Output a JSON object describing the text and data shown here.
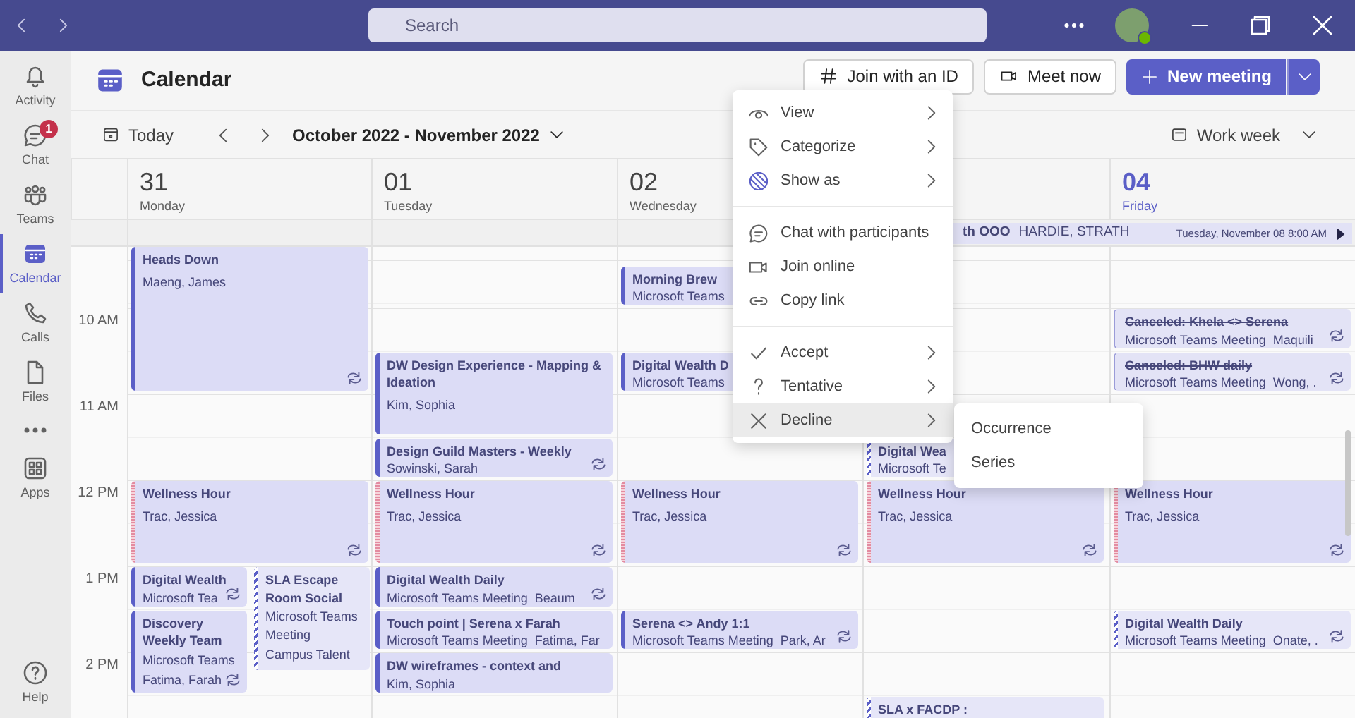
{
  "title_bar": {
    "search_placeholder": "Search"
  },
  "sidebar": {
    "items": [
      {
        "label": "Activity",
        "selected": false
      },
      {
        "label": "Chat",
        "badge": "1",
        "selected": false
      },
      {
        "label": "Teams",
        "selected": false
      },
      {
        "label": "Calendar",
        "selected": true
      },
      {
        "label": "Calls",
        "selected": false
      },
      {
        "label": "Files",
        "selected": false
      },
      {
        "selected": false
      },
      {
        "label": "Apps",
        "selected": false
      }
    ],
    "help": {
      "label": "Help"
    }
  },
  "header": {
    "title": "Calendar",
    "buttons": [
      {
        "label": "Join with an ID"
      },
      {
        "label": "Meet now"
      }
    ],
    "primary": {
      "label": "New meeting"
    }
  },
  "toolbar": {
    "today": "Today",
    "range": "October 2022 - November 2022",
    "view": "Work week"
  },
  "time_labels": [
    "10 AM",
    "11 AM",
    "12 PM",
    "1 PM",
    "2 PM"
  ],
  "days": [
    {
      "number": "31",
      "weekday": "Monday",
      "today": false,
      "events": [
        {
          "title": "Heads Down",
          "people": "Maeng, James",
          "kind": "accepted",
          "recurring": true
        },
        {
          "title": "Wellness Hour",
          "people": "Trac, Jessica",
          "kind": "free",
          "recurring": true
        },
        {
          "title": "Digital Wealth",
          "location": "Microsoft Tea",
          "kind": "accepted",
          "recurring": true
        },
        {
          "title": "SLA Escape Room Social",
          "location": "Microsoft Teams Meeting",
          "people": "Campus Talent",
          "kind": "tentative",
          "recurring": false
        },
        {
          "title": "Discovery Weekly Team",
          "location": "Microsoft Teams",
          "people": "Fatima, Farah",
          "kind": "accepted",
          "recurring": true
        }
      ]
    },
    {
      "number": "01",
      "weekday": "Tuesday",
      "today": false,
      "events": [
        {
          "title": "DW Design Experience - Mapping & Ideation",
          "people": "Kim, Sophia",
          "kind": "accepted",
          "recurring": false
        },
        {
          "title": "Design Guild Masters - Weekly",
          "people": "Sowinski, Sarah",
          "kind": "accepted",
          "recurring": true
        },
        {
          "title": "Wellness Hour",
          "people": "Trac, Jessica",
          "kind": "free",
          "recurring": true
        },
        {
          "title": "Digital Wealth Daily",
          "location": "Microsoft Teams Meeting",
          "people": "Beaum",
          "kind": "accepted",
          "recurring": true
        },
        {
          "title": "Touch point | Serena x Farah",
          "location": "Microsoft Teams Meeting",
          "people": "Fatima, Far",
          "kind": "accepted",
          "recurring": false
        },
        {
          "title": "DW wireframes - context and",
          "people": "Kim, Sophia",
          "kind": "accepted",
          "recurring": false
        }
      ]
    },
    {
      "number": "02",
      "weekday": "Wednesday",
      "today": false,
      "events": [
        {
          "title": "Morning Brew",
          "location": "Microsoft Teams",
          "kind": "accepted",
          "recurring": false
        },
        {
          "title": "Digital Wealth D",
          "location": "Microsoft Teams",
          "kind": "accepted",
          "recurring": false
        },
        {
          "title": "Wellness Hour",
          "people": "Trac, Jessica",
          "kind": "free",
          "recurring": true
        },
        {
          "title": "Serena <> Andy 1:1",
          "location": "Microsoft Teams Meeting",
          "people": "Park, Ar",
          "kind": "accepted",
          "recurring": true
        }
      ]
    },
    {
      "all_day_event": {
        "title": "th OOO",
        "people": "HARDIE, STRATH",
        "until": "Tuesday, November 08 8:00 AM"
      },
      "events": [
        {
          "title": "Digital Wea",
          "location": "Microsoft Te",
          "kind": "tentative",
          "recurring": false
        },
        {
          "title": "Wellness Hour",
          "people": "Trac, Jessica",
          "kind": "free",
          "recurring": true
        },
        {
          "title": "SLA x FACDP :",
          "kind": "tentative",
          "recurring": false
        }
      ]
    },
    {
      "number": "04",
      "weekday": "Friday",
      "today": true,
      "events": [
        {
          "title": "Canceled: Khela <> Serena",
          "location": "Microsoft Teams Meeting",
          "people": "Maquili",
          "kind": "canceled",
          "recurring": true
        },
        {
          "title": "Canceled: BHW daily",
          "location": "Microsoft Teams Meeting",
          "people": "Wong, .",
          "kind": "canceled",
          "recurring": true
        },
        {
          "title": "Wellness Hour",
          "people": "Trac, Jessica",
          "kind": "free",
          "recurring": true
        },
        {
          "title": "Digital Wealth Daily",
          "location": "Microsoft Teams Meeting",
          "people": "Onate, .",
          "kind": "tentative",
          "recurring": true
        }
      ]
    }
  ],
  "context_menu": {
    "sections": [
      [
        {
          "label": "View",
          "submenu": true,
          "selected": false
        },
        {
          "label": "Categorize",
          "submenu": true,
          "selected": false
        },
        {
          "label": "Show as",
          "submenu": true,
          "selected": false
        }
      ],
      [
        {
          "label": "Chat with participants",
          "submenu": false,
          "selected": false
        },
        {
          "label": "Join online",
          "submenu": false,
          "selected": false
        },
        {
          "label": "Copy link",
          "submenu": false,
          "selected": false
        }
      ],
      [
        {
          "label": "Accept",
          "submenu": true,
          "selected": false
        },
        {
          "label": "Tentative",
          "submenu": true,
          "selected": false
        },
        {
          "label": "Decline",
          "submenu": true,
          "selected": true
        }
      ]
    ],
    "submenu": [
      {
        "label": "Occurrence"
      },
      {
        "label": "Series"
      }
    ]
  }
}
